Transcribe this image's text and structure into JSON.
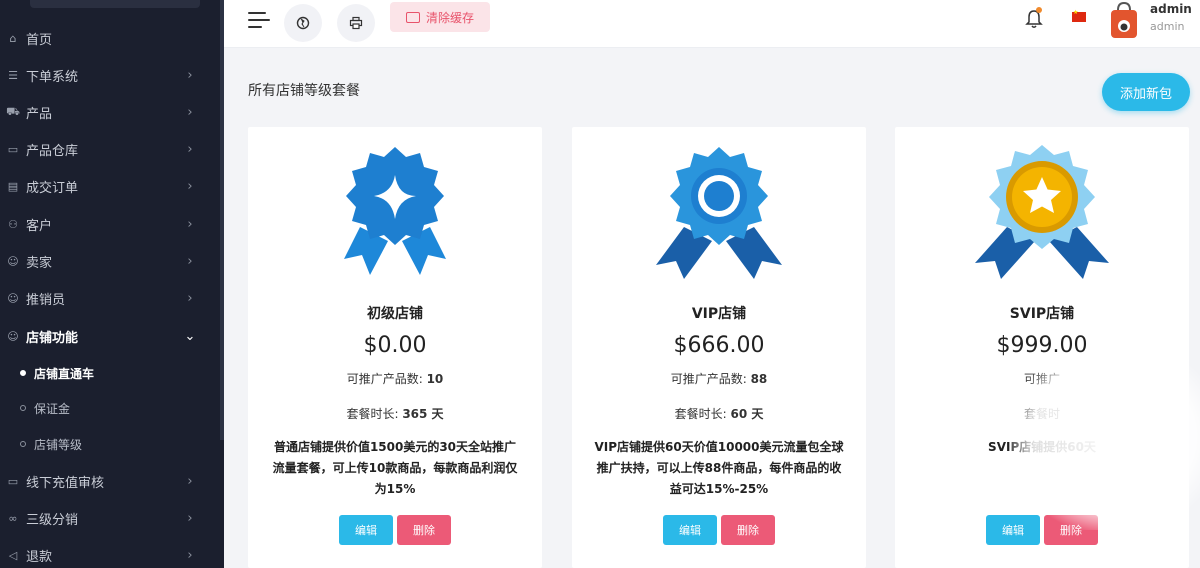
{
  "sidebar": {
    "items": [
      {
        "label": "首页",
        "icon": "home-icon",
        "chevron": false
      },
      {
        "label": "下单系统",
        "icon": "list-icon",
        "chevron": true
      },
      {
        "label": "产品",
        "icon": "cart-icon",
        "chevron": true
      },
      {
        "label": "产品仓库",
        "icon": "box-icon",
        "chevron": true
      },
      {
        "label": "成交订单",
        "icon": "order-icon",
        "chevron": true
      },
      {
        "label": "客户",
        "icon": "users-icon",
        "chevron": true
      },
      {
        "label": "卖家",
        "icon": "user-icon",
        "chevron": true
      },
      {
        "label": "推销员",
        "icon": "user-icon",
        "chevron": true
      },
      {
        "label": "店铺功能",
        "icon": "user-icon",
        "chevron": true,
        "expanded": true
      },
      {
        "label": "线下充值审核",
        "icon": "card-icon",
        "chevron": true
      },
      {
        "label": "三级分销",
        "icon": "link-icon",
        "chevron": true
      },
      {
        "label": "退款",
        "icon": "return-icon",
        "chevron": true
      }
    ],
    "subitems": [
      {
        "label": "店铺直通车",
        "current": true
      },
      {
        "label": "保证金",
        "current": false
      },
      {
        "label": "店铺等级",
        "current": false
      }
    ]
  },
  "topbar": {
    "clear_cache_label": "清除缓存",
    "user_name": "admin",
    "user_role": "admin",
    "notification_dot_color": "#f08a2c"
  },
  "main": {
    "title": "所有店铺等级套餐",
    "add_button": "添加新包",
    "cards": [
      {
        "name": "初级店铺",
        "price": "$0.00",
        "products_label": "可推广产品数:",
        "products_value": "10",
        "duration_label": "套餐时长:",
        "duration_value": "365 天",
        "description": "普通店铺提供价值1500美元的30天全站推广流量套餐，可上传10款商品，每款商品利润仅为15%",
        "edit_label": "编辑",
        "delete_label": "删除",
        "badge_icon": "diamond-ribbon-badge-icon"
      },
      {
        "name": "VIP店铺",
        "price": "$666.00",
        "products_label": "可推广产品数:",
        "products_value": "88",
        "duration_label": "套餐时长:",
        "duration_value": "60 天",
        "description": "VIP店铺提供60天价值10000美元流量包全球推广扶持，可以上传88件商品，每件商品的收益可达15%-25%",
        "edit_label": "编辑",
        "delete_label": "删除",
        "badge_icon": "ring-ribbon-badge-icon"
      },
      {
        "name": "SVIP店铺",
        "price": "$999.00",
        "products_label": "可推广",
        "duration_label": "套餐时",
        "description": "SVIP店铺提供60天",
        "edit_label": "编辑",
        "delete_label": "删除",
        "badge_icon": "star-ribbon-badge-icon"
      }
    ]
  },
  "colors": {
    "sidebar_bg": "#1b1f2e",
    "accent_blue": "#2bb9e8",
    "delete_pink": "#ec5a77",
    "badge_blue": "#1e88d9",
    "badge_gold": "#f4b400"
  }
}
